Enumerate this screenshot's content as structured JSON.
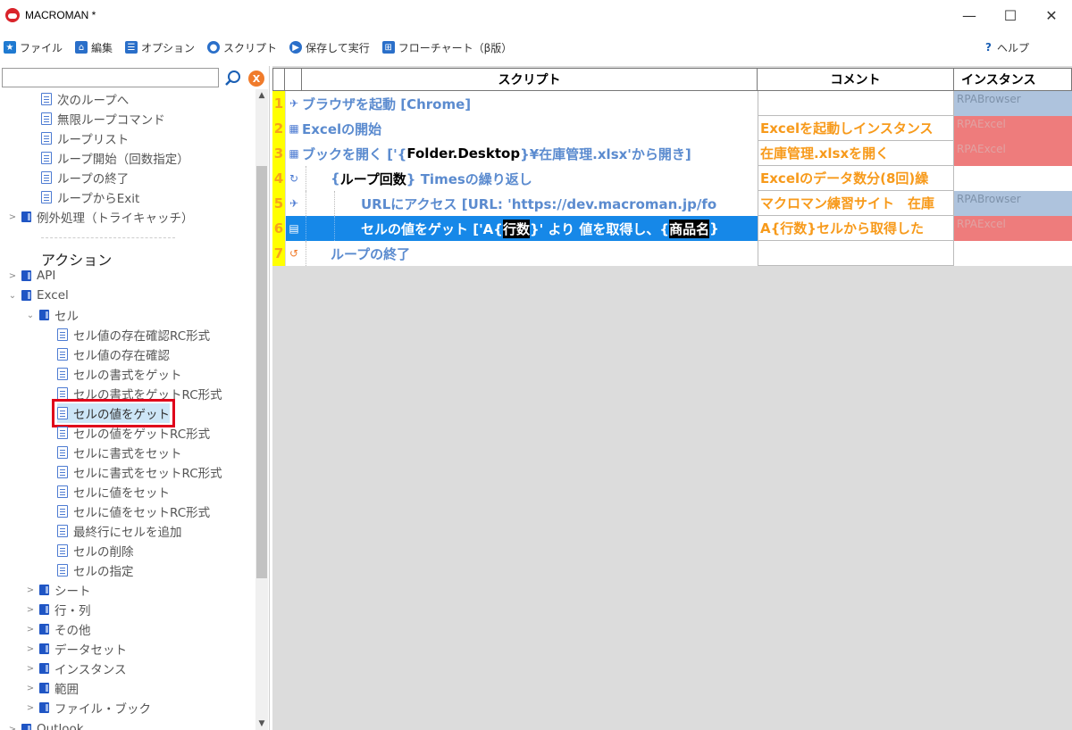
{
  "window": {
    "title": "MACROMAN *",
    "controls": {
      "minimize": "—",
      "maximize": "☐",
      "close": "✕"
    }
  },
  "toolbar": {
    "file": "ファイル",
    "edit": "編集",
    "options": "オプション",
    "script": "スクリプト",
    "save_run": "保存して実行",
    "flowchart": "フローチャート（β版）",
    "help_q": "?",
    "help": "ヘルプ"
  },
  "search": {
    "value": "",
    "placeholder": "",
    "clear_label": "X"
  },
  "tree": {
    "loop_items": [
      "次のループへ",
      "無限ループコマンド",
      "ループリスト",
      "ループ開始（回数指定）",
      "ループの終了",
      "ループからExit"
    ],
    "exception": "例外処理（トライキャッチ）",
    "actions_header": "アクション",
    "api": "API",
    "excel": "Excel",
    "cell": "セル",
    "cell_items": [
      "セル値の存在確認RC形式",
      "セル値の存在確認",
      "セルの書式をゲット",
      "セルの書式をゲットRC形式",
      "セルの値をゲット",
      "セルの値をゲットRC形式",
      "セルに書式をセット",
      "セルに書式をセットRC形式",
      "セルに値をセット",
      "セルに値をセットRC形式",
      "最終行にセルを追加",
      "セルの削除",
      "セルの指定"
    ],
    "groups": [
      "シート",
      "行・列",
      "その他",
      "データセット",
      "インスタンス",
      "範囲",
      "ファイル・ブック",
      "Outlook"
    ]
  },
  "grid": {
    "headers": {
      "script": "スクリプト",
      "comment": "コメント",
      "instance": "インスタンス"
    },
    "rows": [
      {
        "num": "1",
        "icon": "✈",
        "s1": "ブラウザを起動 [Chrome]",
        "comment": "",
        "instance": "RPABrowser"
      },
      {
        "num": "2",
        "icon": "▦",
        "s1": "Excelの開始",
        "comment": "Excelを起動しインスタンス",
        "instance": "RPAExcel"
      },
      {
        "num": "3",
        "icon": "▦",
        "s1": "ブックを開く ['{",
        "s2": "Folder.Desktop",
        "s3": "}¥在庫管理.xlsx'から開き]",
        "comment": "在庫管理.xlsxを開く",
        "instance": "RPAExcel"
      },
      {
        "num": "4",
        "icon": "↻",
        "s1": "{",
        "s2": "ループ回数",
        "s3": "} Timesの繰り返し",
        "comment": "Excelのデータ数分(8回)繰",
        "instance": ""
      },
      {
        "num": "5",
        "icon": "✈",
        "s1": "URLにアクセス [URL: 'https://dev.macroman.jp/fo",
        "comment": "マクロマン練習サイト　在庫",
        "instance": "RPABrowser"
      },
      {
        "num": "6",
        "icon": "▤",
        "s1": "セルの値をゲット ['A{",
        "s2": "行数",
        "s3": "}' より 値を取得し、{",
        "s4": "商品名",
        "s5": "}",
        "comment": "A{行数}セルから取得した",
        "instance": "RPAExcel"
      },
      {
        "num": "7",
        "icon": "↺",
        "s1": "ループの終了",
        "comment": "",
        "instance": ""
      }
    ]
  },
  "colors": {
    "accent_blue": "#1688e8",
    "comment_orange": "#f79a1b",
    "line_yellow": "#ffff00",
    "browser_inst": "#aec3dd",
    "excel_inst": "#ee7c7c",
    "highlight_red": "#e0001a"
  }
}
